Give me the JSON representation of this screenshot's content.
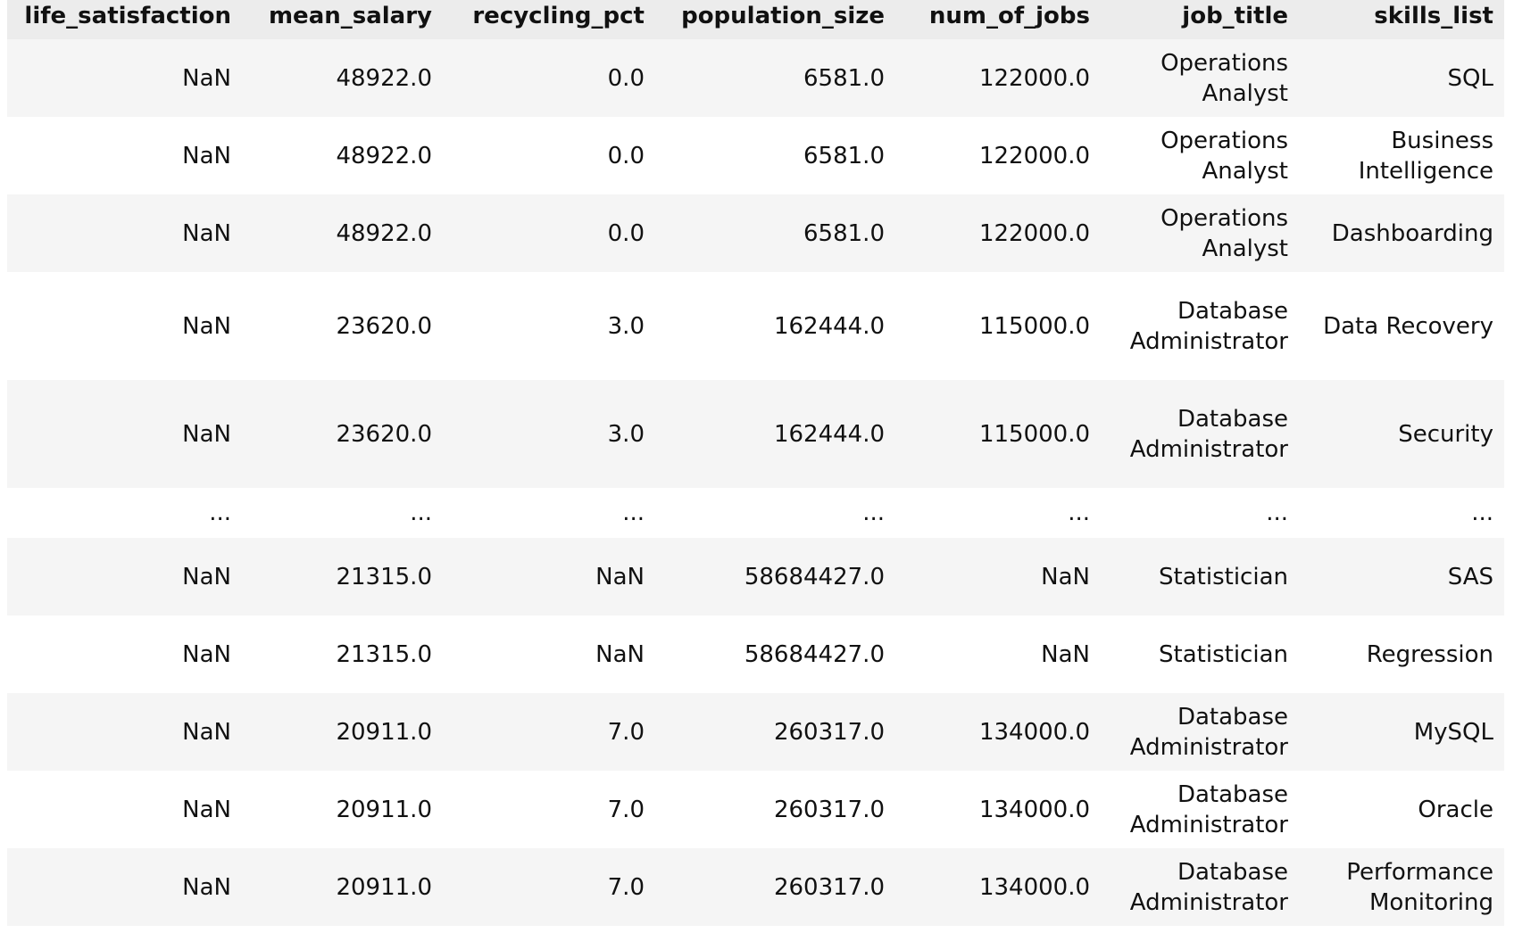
{
  "table": {
    "columns": [
      "life_satisfaction",
      "mean_salary",
      "recycling_pct",
      "population_size",
      "num_of_jobs",
      "job_title",
      "skills_list"
    ],
    "rows": [
      [
        "NaN",
        "48922.0",
        "0.0",
        "6581.0",
        "122000.0",
        "Operations Analyst",
        "SQL"
      ],
      [
        "NaN",
        "48922.0",
        "0.0",
        "6581.0",
        "122000.0",
        "Operations Analyst",
        "Business Intelligence"
      ],
      [
        "NaN",
        "48922.0",
        "0.0",
        "6581.0",
        "122000.0",
        "Operations Analyst",
        "Dashboarding"
      ],
      [
        "NaN",
        "23620.0",
        "3.0",
        "162444.0",
        "115000.0",
        "Database Administrator",
        "Data Recovery"
      ],
      [
        "NaN",
        "23620.0",
        "3.0",
        "162444.0",
        "115000.0",
        "Database Administrator",
        "Security"
      ],
      [
        "...",
        "...",
        "...",
        "...",
        "...",
        "...",
        "..."
      ],
      [
        "NaN",
        "21315.0",
        "NaN",
        "58684427.0",
        "NaN",
        "Statistician",
        "SAS"
      ],
      [
        "NaN",
        "21315.0",
        "NaN",
        "58684427.0",
        "NaN",
        "Statistician",
        "Regression"
      ],
      [
        "NaN",
        "20911.0",
        "7.0",
        "260317.0",
        "134000.0",
        "Database Administrator",
        "MySQL"
      ],
      [
        "NaN",
        "20911.0",
        "7.0",
        "260317.0",
        "134000.0",
        "Database Administrator",
        "Oracle"
      ],
      [
        "NaN",
        "20911.0",
        "7.0",
        "260317.0",
        "134000.0",
        "Database Administrator",
        "Performance Monitoring"
      ]
    ]
  }
}
